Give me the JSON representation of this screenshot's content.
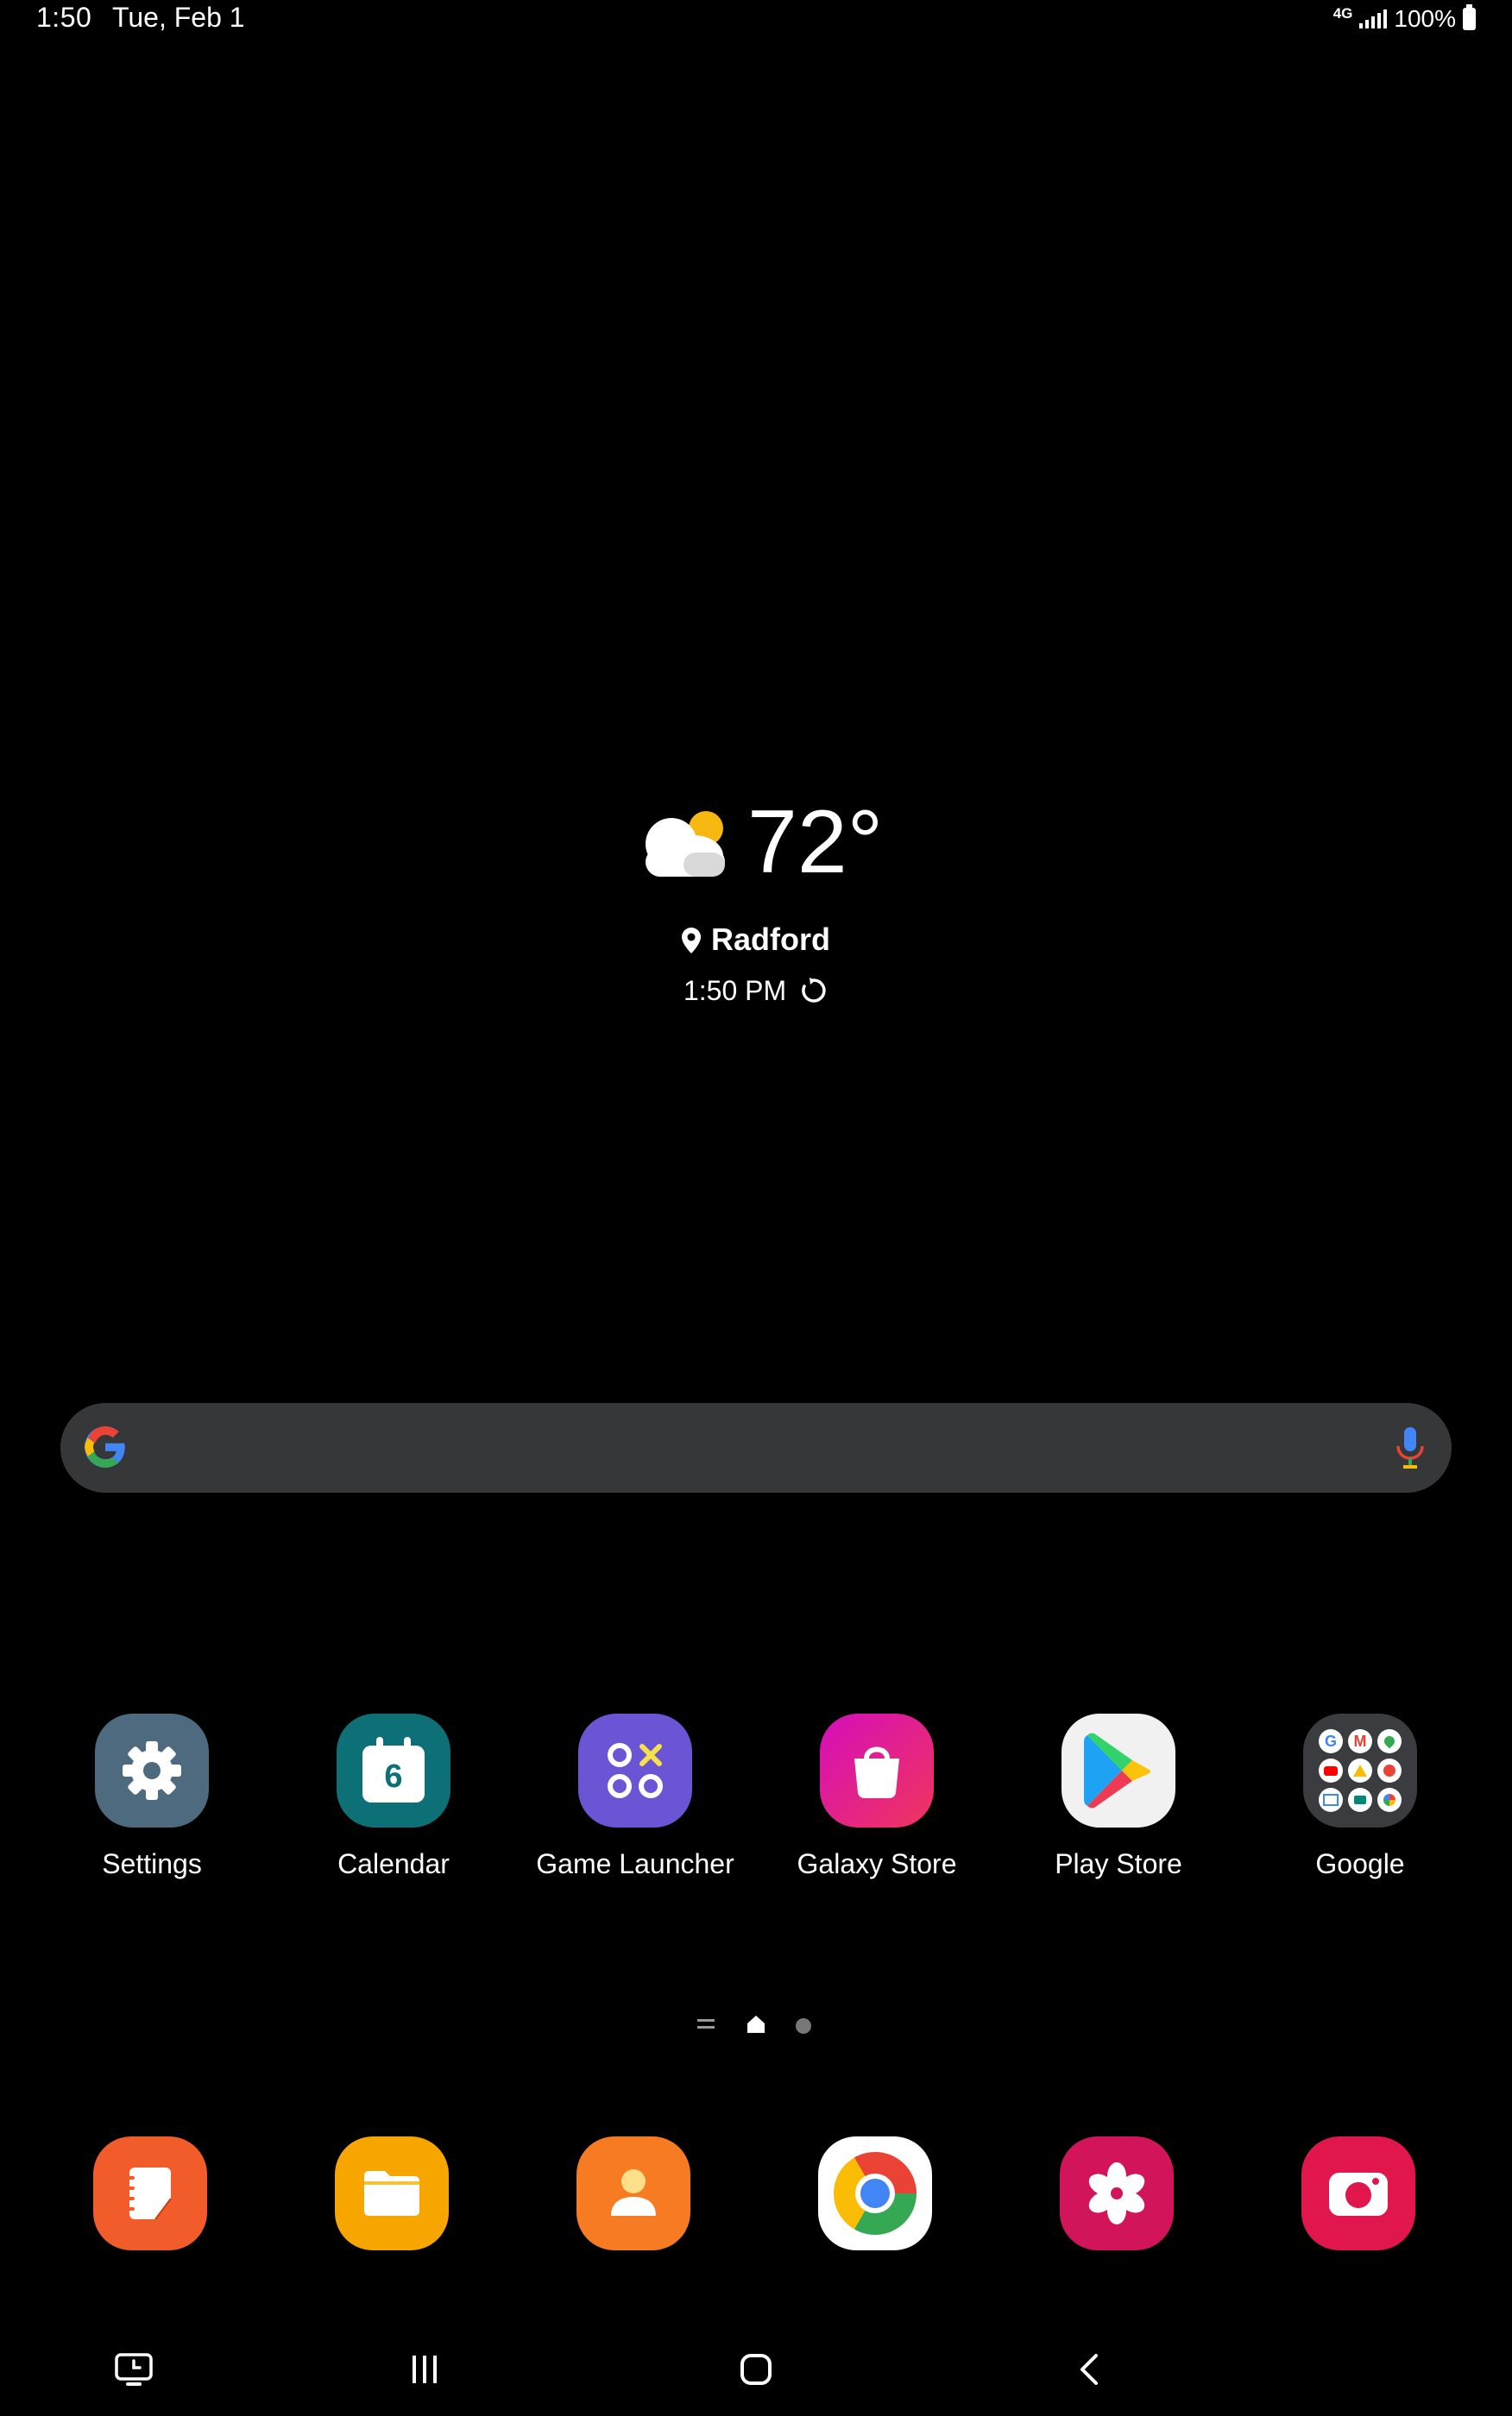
{
  "status_bar": {
    "time": "1:50",
    "date": "Tue, Feb 1",
    "network": "4G",
    "battery": "100%"
  },
  "weather": {
    "icon": "partly-cloudy-icon",
    "temperature": "72°",
    "location": "Radford",
    "updated_time": "1:50 PM"
  },
  "search": {
    "icon_left": "google-g-icon",
    "icon_right": "microphone-icon"
  },
  "home_apps": [
    {
      "label": "Settings",
      "icon": "settings-icon",
      "color": "#4E6A7E"
    },
    {
      "label": "Calendar",
      "icon": "calendar-icon",
      "color": "#0E7077",
      "day": "6"
    },
    {
      "label": "Game Launcher",
      "icon": "game-launcher-icon",
      "color": "#6B55D5"
    },
    {
      "label": "Galaxy Store",
      "icon": "galaxy-store-icon",
      "color": "#E4178B"
    },
    {
      "label": "Play Store",
      "icon": "play-store-icon",
      "color": "#F1F1F1"
    },
    {
      "label": "Google",
      "icon": "google-folder-icon",
      "color": "#3A3C40"
    }
  ],
  "dock_apps": [
    {
      "icon": "samsung-notes-icon",
      "color": "#F25C2A"
    },
    {
      "icon": "my-files-icon",
      "color": "#F7A600"
    },
    {
      "icon": "contacts-icon",
      "color": "#F77B22"
    },
    {
      "icon": "chrome-icon",
      "color": "#FFFFFF"
    },
    {
      "icon": "gallery-icon",
      "color": "#D2145A"
    },
    {
      "icon": "camera-icon",
      "color": "#E0164C"
    }
  ],
  "page_indicator": [
    "menu-icon",
    "home-icon",
    "page-dot"
  ],
  "nav_bar": [
    "screen-recorder-icon",
    "recents-button",
    "home-button",
    "back-button"
  ]
}
